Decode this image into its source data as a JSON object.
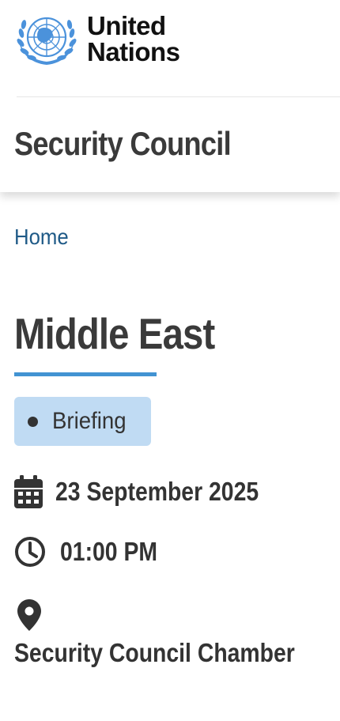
{
  "header": {
    "logo": {
      "line1": "United",
      "line2": "Nations",
      "emblem_icon": "un-emblem-icon",
      "emblem_color": "#4b92db"
    },
    "site_title": "Security Council"
  },
  "breadcrumb": {
    "home_label": "Home"
  },
  "event": {
    "title": "Middle East",
    "type_badge": "Briefing",
    "date": "23 September 2025",
    "time": "01:00 PM",
    "location": "Security Council Chamber",
    "icons": {
      "date": "calendar-icon",
      "time": "clock-icon",
      "location": "map-pin-icon"
    }
  },
  "colors": {
    "accent_underline": "#4293d2",
    "badge_background": "#c0dbf3",
    "link": "#1f5a87",
    "text": "#333333"
  }
}
